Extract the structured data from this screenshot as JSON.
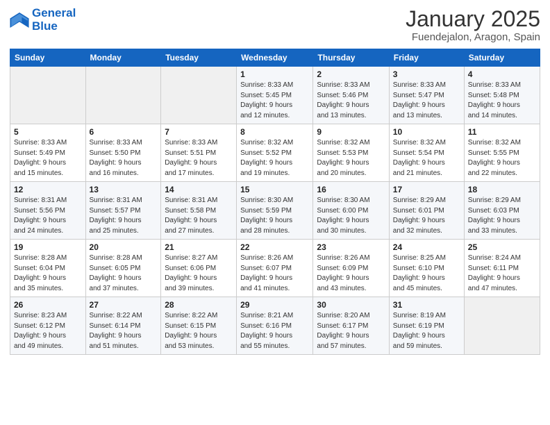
{
  "header": {
    "logo_line1": "General",
    "logo_line2": "Blue",
    "main_title": "January 2025",
    "subtitle": "Fuendejalon, Aragon, Spain"
  },
  "days_of_week": [
    "Sunday",
    "Monday",
    "Tuesday",
    "Wednesday",
    "Thursday",
    "Friday",
    "Saturday"
  ],
  "weeks": [
    [
      {
        "day": "",
        "info": ""
      },
      {
        "day": "",
        "info": ""
      },
      {
        "day": "",
        "info": ""
      },
      {
        "day": "1",
        "info": "Sunrise: 8:33 AM\nSunset: 5:45 PM\nDaylight: 9 hours\nand 12 minutes."
      },
      {
        "day": "2",
        "info": "Sunrise: 8:33 AM\nSunset: 5:46 PM\nDaylight: 9 hours\nand 13 minutes."
      },
      {
        "day": "3",
        "info": "Sunrise: 8:33 AM\nSunset: 5:47 PM\nDaylight: 9 hours\nand 13 minutes."
      },
      {
        "day": "4",
        "info": "Sunrise: 8:33 AM\nSunset: 5:48 PM\nDaylight: 9 hours\nand 14 minutes."
      }
    ],
    [
      {
        "day": "5",
        "info": "Sunrise: 8:33 AM\nSunset: 5:49 PM\nDaylight: 9 hours\nand 15 minutes."
      },
      {
        "day": "6",
        "info": "Sunrise: 8:33 AM\nSunset: 5:50 PM\nDaylight: 9 hours\nand 16 minutes."
      },
      {
        "day": "7",
        "info": "Sunrise: 8:33 AM\nSunset: 5:51 PM\nDaylight: 9 hours\nand 17 minutes."
      },
      {
        "day": "8",
        "info": "Sunrise: 8:32 AM\nSunset: 5:52 PM\nDaylight: 9 hours\nand 19 minutes."
      },
      {
        "day": "9",
        "info": "Sunrise: 8:32 AM\nSunset: 5:53 PM\nDaylight: 9 hours\nand 20 minutes."
      },
      {
        "day": "10",
        "info": "Sunrise: 8:32 AM\nSunset: 5:54 PM\nDaylight: 9 hours\nand 21 minutes."
      },
      {
        "day": "11",
        "info": "Sunrise: 8:32 AM\nSunset: 5:55 PM\nDaylight: 9 hours\nand 22 minutes."
      }
    ],
    [
      {
        "day": "12",
        "info": "Sunrise: 8:31 AM\nSunset: 5:56 PM\nDaylight: 9 hours\nand 24 minutes."
      },
      {
        "day": "13",
        "info": "Sunrise: 8:31 AM\nSunset: 5:57 PM\nDaylight: 9 hours\nand 25 minutes."
      },
      {
        "day": "14",
        "info": "Sunrise: 8:31 AM\nSunset: 5:58 PM\nDaylight: 9 hours\nand 27 minutes."
      },
      {
        "day": "15",
        "info": "Sunrise: 8:30 AM\nSunset: 5:59 PM\nDaylight: 9 hours\nand 28 minutes."
      },
      {
        "day": "16",
        "info": "Sunrise: 8:30 AM\nSunset: 6:00 PM\nDaylight: 9 hours\nand 30 minutes."
      },
      {
        "day": "17",
        "info": "Sunrise: 8:29 AM\nSunset: 6:01 PM\nDaylight: 9 hours\nand 32 minutes."
      },
      {
        "day": "18",
        "info": "Sunrise: 8:29 AM\nSunset: 6:03 PM\nDaylight: 9 hours\nand 33 minutes."
      }
    ],
    [
      {
        "day": "19",
        "info": "Sunrise: 8:28 AM\nSunset: 6:04 PM\nDaylight: 9 hours\nand 35 minutes."
      },
      {
        "day": "20",
        "info": "Sunrise: 8:28 AM\nSunset: 6:05 PM\nDaylight: 9 hours\nand 37 minutes."
      },
      {
        "day": "21",
        "info": "Sunrise: 8:27 AM\nSunset: 6:06 PM\nDaylight: 9 hours\nand 39 minutes."
      },
      {
        "day": "22",
        "info": "Sunrise: 8:26 AM\nSunset: 6:07 PM\nDaylight: 9 hours\nand 41 minutes."
      },
      {
        "day": "23",
        "info": "Sunrise: 8:26 AM\nSunset: 6:09 PM\nDaylight: 9 hours\nand 43 minutes."
      },
      {
        "day": "24",
        "info": "Sunrise: 8:25 AM\nSunset: 6:10 PM\nDaylight: 9 hours\nand 45 minutes."
      },
      {
        "day": "25",
        "info": "Sunrise: 8:24 AM\nSunset: 6:11 PM\nDaylight: 9 hours\nand 47 minutes."
      }
    ],
    [
      {
        "day": "26",
        "info": "Sunrise: 8:23 AM\nSunset: 6:12 PM\nDaylight: 9 hours\nand 49 minutes."
      },
      {
        "day": "27",
        "info": "Sunrise: 8:22 AM\nSunset: 6:14 PM\nDaylight: 9 hours\nand 51 minutes."
      },
      {
        "day": "28",
        "info": "Sunrise: 8:22 AM\nSunset: 6:15 PM\nDaylight: 9 hours\nand 53 minutes."
      },
      {
        "day": "29",
        "info": "Sunrise: 8:21 AM\nSunset: 6:16 PM\nDaylight: 9 hours\nand 55 minutes."
      },
      {
        "day": "30",
        "info": "Sunrise: 8:20 AM\nSunset: 6:17 PM\nDaylight: 9 hours\nand 57 minutes."
      },
      {
        "day": "31",
        "info": "Sunrise: 8:19 AM\nSunset: 6:19 PM\nDaylight: 9 hours\nand 59 minutes."
      },
      {
        "day": "",
        "info": ""
      }
    ]
  ]
}
